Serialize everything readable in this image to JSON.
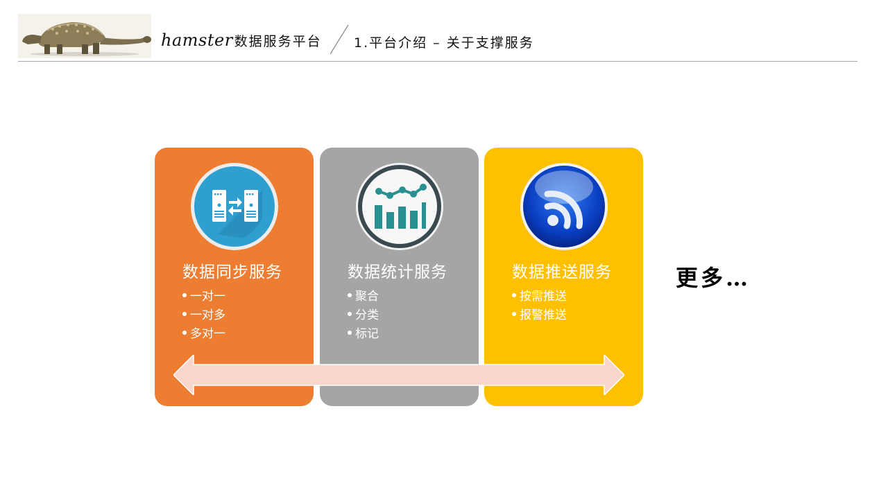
{
  "header": {
    "brand_name": "hamster",
    "brand_suffix": "数据服务平台",
    "section_title": "1.平台介绍 – 关于支撑服务",
    "logo_icon": "ankylosaurus-dinosaur-icon"
  },
  "cards": [
    {
      "title": "数据同步服务",
      "items": [
        "一对一",
        "一对多",
        "多对一"
      ],
      "color": "#ED7D31",
      "icon": "server-sync-icon"
    },
    {
      "title": "数据统计服务",
      "items": [
        "聚合",
        "分类",
        "标记"
      ],
      "color": "#A5A5A5",
      "icon": "bar-chart-icon"
    },
    {
      "title": "数据推送服务",
      "items": [
        "按需推送",
        "报警推送"
      ],
      "color": "#FFC000",
      "icon": "rss-feed-icon"
    }
  ],
  "more_text": "更多…",
  "colors": {
    "arrow_fill": "#F8D6CB",
    "header_rule": "#A8A8A8"
  }
}
